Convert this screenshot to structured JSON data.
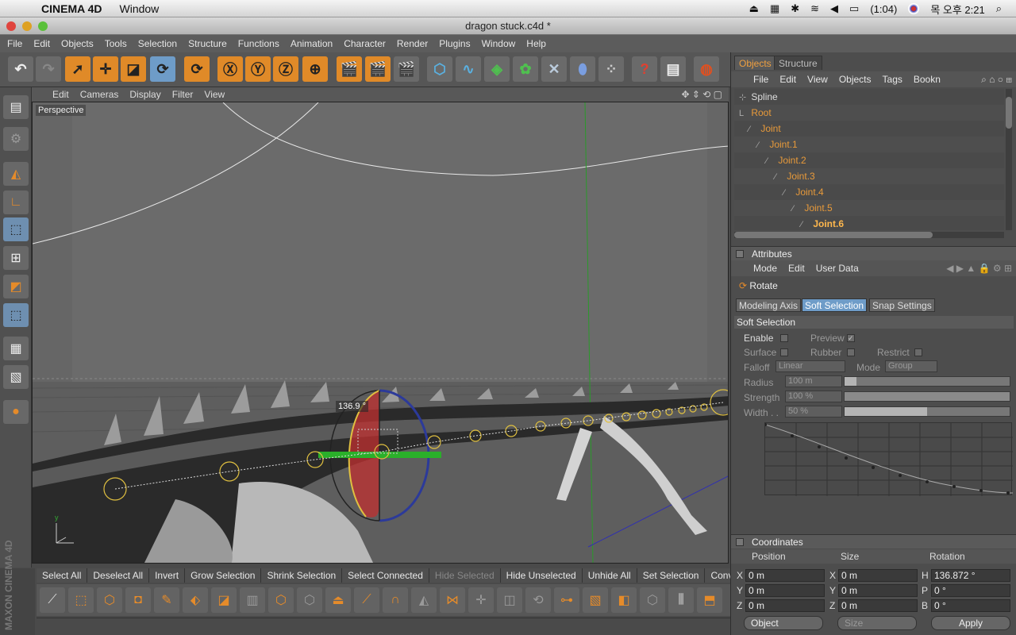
{
  "macbar": {
    "app_name": "CINEMA 4D",
    "menu_window": "Window",
    "battery": "(1:04)",
    "clock": "목 오후 2:21"
  },
  "window": {
    "title": "dragon stuck.c4d *"
  },
  "app_menu": [
    "File",
    "Edit",
    "Objects",
    "Tools",
    "Selection",
    "Structure",
    "Functions",
    "Animation",
    "Character",
    "Render",
    "Plugins",
    "Window",
    "Help"
  ],
  "viewport": {
    "menu": [
      "Edit",
      "Cameras",
      "Display",
      "Filter",
      "View"
    ],
    "label": "Perspective",
    "rotation_readout": "136.9 °"
  },
  "selection_bar": [
    "Select All",
    "Deselect All",
    "Invert",
    "Grow Selection",
    "Shrink Selection",
    "Select Connected",
    "Hide Selected",
    "Hide Unselected",
    "Unhide All",
    "Set Selection",
    "Conve"
  ],
  "maxon_logo": "MAXON CINEMA 4D",
  "objects_panel": {
    "tabs": [
      "Objects",
      "Structure"
    ],
    "menu": [
      "File",
      "Edit",
      "View",
      "Objects",
      "Tags",
      "Bookn"
    ],
    "tree": [
      {
        "name": "Spline",
        "depth": 0
      },
      {
        "name": "Root",
        "depth": 0
      },
      {
        "name": "Joint",
        "depth": 1
      },
      {
        "name": "Joint.1",
        "depth": 2
      },
      {
        "name": "Joint.2",
        "depth": 3
      },
      {
        "name": "Joint.3",
        "depth": 4
      },
      {
        "name": "Joint.4",
        "depth": 5
      },
      {
        "name": "Joint.5",
        "depth": 6
      },
      {
        "name": "Joint.6",
        "depth": 7
      }
    ]
  },
  "attributes": {
    "header": "Attributes",
    "menu": [
      "Mode",
      "Edit",
      "User Data"
    ],
    "tool": "Rotate",
    "subtabs": [
      "Modeling Axis",
      "Soft Selection",
      "Snap Settings"
    ],
    "section": "Soft Selection",
    "enable": "Enable",
    "preview": "Preview",
    "surface": "Surface",
    "rubber": "Rubber",
    "restrict": "Restrict",
    "falloff_label": "Falloff",
    "falloff_value": "Linear",
    "mode_label": "Mode",
    "mode_value": "Group",
    "radius_label": "Radius",
    "radius_value": "100 m",
    "strength_label": "Strength",
    "strength_value": "100 %",
    "width_label": "Width . .",
    "width_value": "50 %",
    "radius_level": 0.07,
    "strength_level": 1.0,
    "width_level": 0.5
  },
  "coordinates": {
    "header": "Coordinates",
    "col_position": "Position",
    "col_size": "Size",
    "col_rotation": "Rotation",
    "rows": [
      {
        "axis": "X",
        "pos": "0 m",
        "saxis": "X",
        "size": "0 m",
        "raxis": "H",
        "rot": "136.872 °"
      },
      {
        "axis": "Y",
        "pos": "0 m",
        "saxis": "Y",
        "size": "0 m",
        "raxis": "P",
        "rot": "0 °"
      },
      {
        "axis": "Z",
        "pos": "0 m",
        "saxis": "Z",
        "size": "0 m",
        "raxis": "B",
        "rot": "0 °"
      }
    ],
    "mode_select": "Object",
    "size_select": "Size",
    "apply": "Apply"
  }
}
